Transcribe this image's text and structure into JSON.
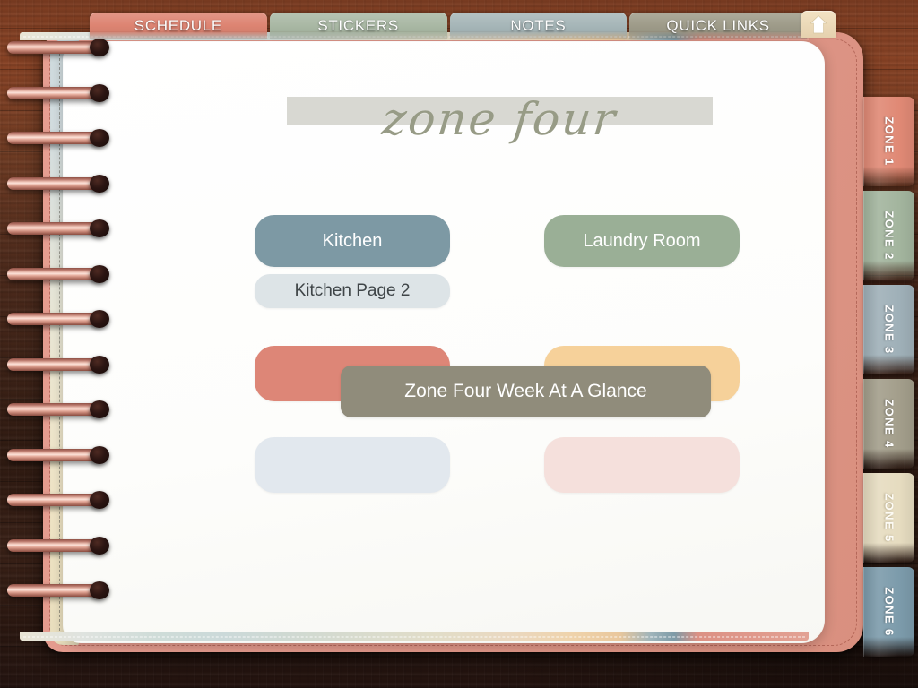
{
  "top_nav": {
    "tabs": [
      {
        "label": "SCHEDULE",
        "color": "#dd8472",
        "name": "tab-schedule"
      },
      {
        "label": "STICKERS",
        "color": "#a9b8a4",
        "name": "tab-stickers"
      },
      {
        "label": "NOTES",
        "color": "#a6b6b8",
        "name": "tab-notes"
      },
      {
        "label": "QUICK LINKS",
        "color": "#9e9b89",
        "name": "tab-quick-links"
      }
    ],
    "home_icon": "home-icon"
  },
  "page": {
    "title": "zone four",
    "title_color": "#979b86",
    "highlight_color": "#d8d8d2"
  },
  "links": {
    "rows": [
      [
        {
          "label": "Kitchen",
          "color": "#7d99a4",
          "text_color": "#ffffff",
          "name": "link-kitchen"
        },
        {
          "label": "Laundry Room",
          "color": "#9aaf96",
          "text_color": "#ffffff",
          "name": "link-laundry-room"
        }
      ],
      [
        {
          "label": "Kitchen Page 2",
          "color": "#dde4e7",
          "text_color": "#3f4548",
          "name": "link-kitchen-page-2"
        },
        {
          "label": "",
          "color": "transparent",
          "text_color": "#ffffff",
          "name": "link-empty-slot"
        }
      ],
      [
        {
          "label": "",
          "color": "#dd8677",
          "text_color": "#ffffff",
          "name": "link-blank-terracotta"
        },
        {
          "label": "",
          "color": "#f6d19a",
          "text_color": "#ffffff",
          "name": "link-blank-peach"
        }
      ],
      [
        {
          "label": "",
          "color": "#e2e8ee",
          "text_color": "#ffffff",
          "name": "link-blank-pale-blue"
        },
        {
          "label": "",
          "color": "#f5e0dc",
          "text_color": "#ffffff",
          "name": "link-blank-blush"
        }
      ]
    ],
    "banner": {
      "label": "Zone Four Week At A Glance",
      "color": "#908c7b",
      "name": "link-week-at-a-glance"
    }
  },
  "zone_tabs": [
    {
      "label": "ZONE 1",
      "color": "#e08975",
      "light": false,
      "name": "zone-tab-1"
    },
    {
      "label": "ZONE 2",
      "color": "#a3b59e",
      "light": false,
      "name": "zone-tab-2"
    },
    {
      "label": "ZONE 3",
      "color": "#9fb0b8",
      "light": false,
      "name": "zone-tab-3"
    },
    {
      "label": "ZONE 4",
      "color": "#a39e8b",
      "light": false,
      "name": "zone-tab-4"
    },
    {
      "label": "ZONE 5",
      "color": "#e6dcc0",
      "light": true,
      "name": "zone-tab-5"
    },
    {
      "label": "ZONE 6",
      "color": "#7c9bab",
      "light": false,
      "name": "zone-tab-6"
    }
  ],
  "binding": {
    "ring_count": 13,
    "ring_color": "#e8b0a0"
  }
}
